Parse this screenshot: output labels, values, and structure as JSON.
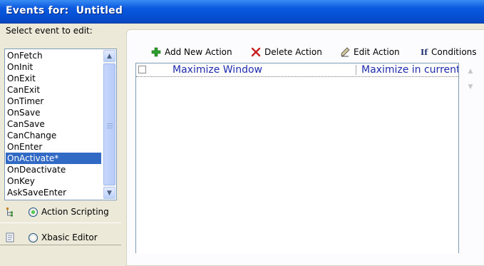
{
  "window": {
    "title_prefix": "Events for:",
    "title_name": "Untitled"
  },
  "left": {
    "select_label": "Select event to edit:",
    "events": [
      {
        "label": "OnFetch",
        "selected": false
      },
      {
        "label": "OnInit",
        "selected": false
      },
      {
        "label": "OnExit",
        "selected": false
      },
      {
        "label": "CanExit",
        "selected": false
      },
      {
        "label": "OnTimer",
        "selected": false
      },
      {
        "label": "OnSave",
        "selected": false
      },
      {
        "label": "CanSave",
        "selected": false
      },
      {
        "label": "CanChange",
        "selected": false
      },
      {
        "label": "OnEnter",
        "selected": false
      },
      {
        "label": "OnActivate*",
        "selected": true
      },
      {
        "label": "OnDeactivate",
        "selected": false
      },
      {
        "label": "OnKey",
        "selected": false
      },
      {
        "label": "AskSaveEnter",
        "selected": false
      }
    ],
    "mode_options": [
      {
        "label": "Action Scripting",
        "checked": true,
        "icon": "action-tree-icon"
      },
      {
        "label": "Xbasic Editor",
        "checked": false,
        "icon": "code-editor-icon"
      }
    ]
  },
  "toolbar": {
    "add_label": "Add New Action",
    "delete_label": "Delete Action",
    "edit_label": "Edit Action",
    "conditions_icon_text": "If",
    "conditions_label": "Conditions"
  },
  "actions": {
    "rows": [
      {
        "name": "Maximize Window",
        "description": "Maximize in current"
      }
    ]
  },
  "colors": {
    "title_bar": "#0553d8",
    "selection": "#316ac5",
    "action_text": "#1f2bad",
    "add_icon": "#2da12d",
    "delete_icon": "#c81e1e"
  }
}
